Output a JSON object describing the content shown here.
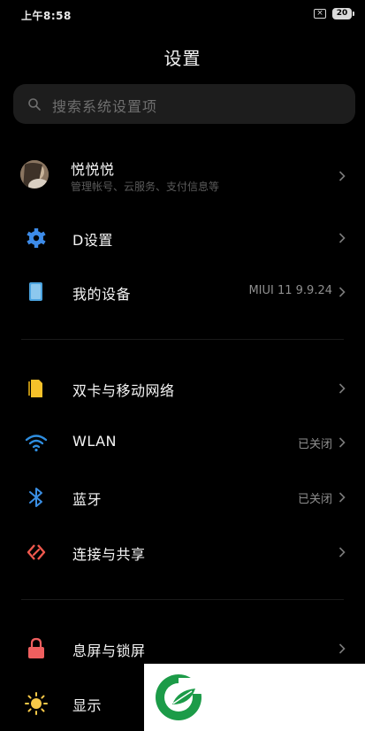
{
  "status_bar": {
    "time": "上午8:58",
    "sim": "×",
    "battery": "20"
  },
  "header": {
    "title": "设置"
  },
  "search": {
    "placeholder": "搜索系统设置项"
  },
  "account": {
    "name": "悦悦悦",
    "subtitle": "管理帐号、云服务、支付信息等"
  },
  "items": [
    {
      "label": "D设置",
      "value": "",
      "icon": "gear-icon",
      "icon_color": "#3d8be8"
    },
    {
      "label": "我的设备",
      "value": "MIUI 11 9.9.24",
      "icon": "device-icon",
      "icon_color": "#4aa3df"
    },
    {
      "label": "双卡与移动网络",
      "value": "",
      "icon": "sim-card-icon",
      "icon_color": "#f6c12a"
    },
    {
      "label": "WLAN",
      "value": "已关闭",
      "icon": "wifi-icon",
      "icon_color": "#2f8ee0"
    },
    {
      "label": "蓝牙",
      "value": "已关闭",
      "icon": "bluetooth-icon",
      "icon_color": "#3a8fe5"
    },
    {
      "label": "连接与共享",
      "value": "",
      "icon": "connection-share-icon",
      "icon_color": "#f0594e"
    },
    {
      "label": "息屏与锁屏",
      "value": "",
      "icon": "lock-icon",
      "icon_color": "#ef5f5f"
    },
    {
      "label": "显示",
      "value": "",
      "icon": "sun-icon",
      "icon_color": "#f7c948"
    }
  ],
  "logo": {
    "color": "#1c9b48"
  }
}
